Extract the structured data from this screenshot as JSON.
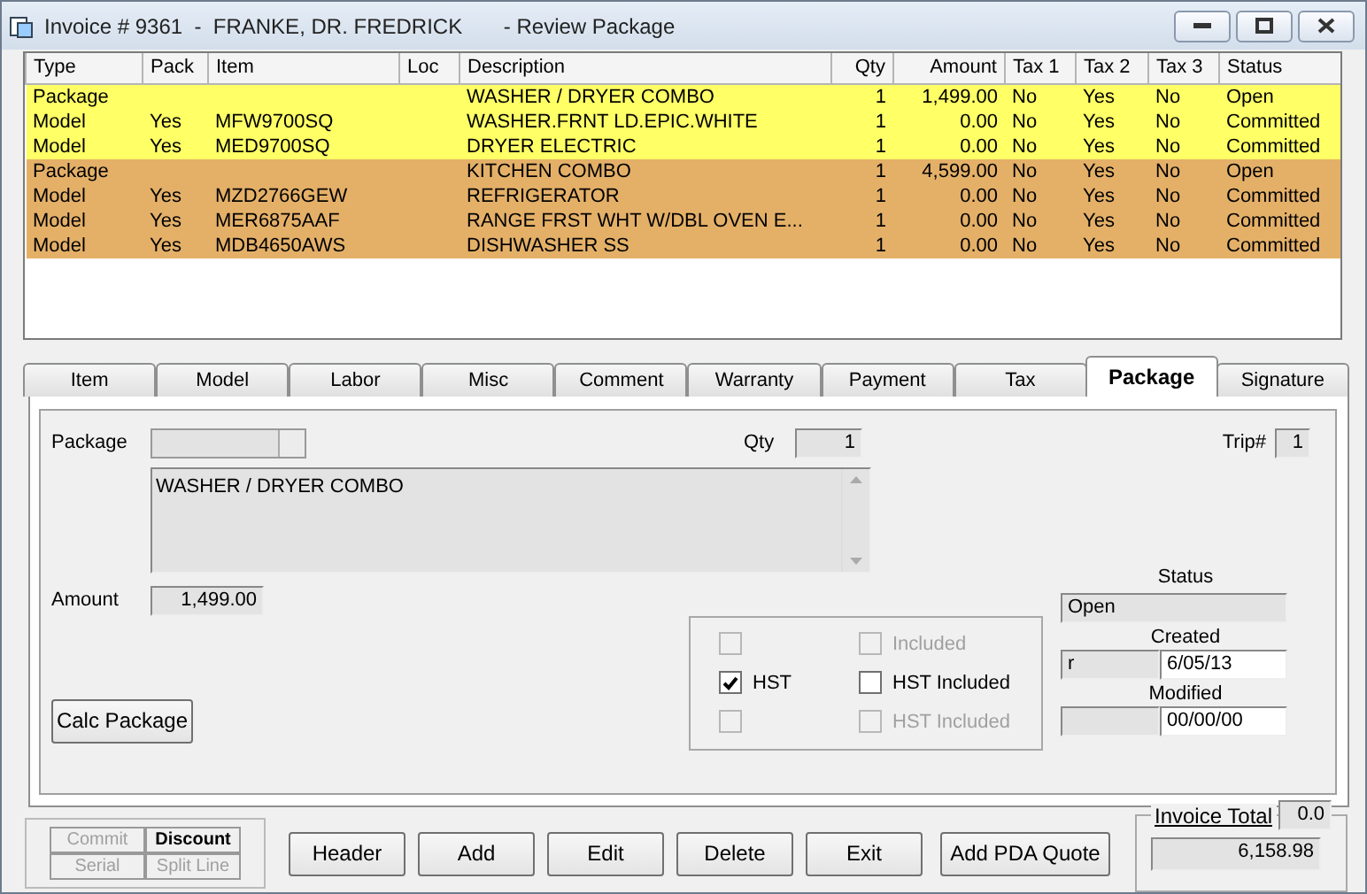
{
  "window": {
    "title": "Invoice # 9361  -  FRANKE, DR. FREDRICK       - Review Package"
  },
  "table": {
    "columns": [
      "Type",
      "Pack",
      "Item",
      "Loc",
      "Description",
      "Qty",
      "Amount",
      "Tax 1",
      "Tax 2",
      "Tax 3",
      "Status"
    ],
    "rows": [
      {
        "color": "#ffff66",
        "cells": [
          "Package",
          "",
          "",
          "",
          "WASHER / DRYER COMBO",
          "1",
          "1,499.00",
          "No",
          "Yes",
          "No",
          "Open"
        ]
      },
      {
        "color": "#ffff66",
        "cells": [
          "Model",
          "Yes",
          "MFW9700SQ",
          "",
          "WASHER.FRNT LD.EPIC.WHITE",
          "1",
          "0.00",
          "No",
          "Yes",
          "No",
          "Committed"
        ]
      },
      {
        "color": "#ffff66",
        "cells": [
          "Model",
          "Yes",
          "MED9700SQ",
          "",
          "DRYER ELECTRIC",
          "1",
          "0.00",
          "No",
          "Yes",
          "No",
          "Committed"
        ]
      },
      {
        "color": "#e4b068",
        "cells": [
          "Package",
          "",
          "",
          "",
          "KITCHEN COMBO",
          "1",
          "4,599.00",
          "No",
          "Yes",
          "No",
          "Open"
        ]
      },
      {
        "color": "#e4b068",
        "cells": [
          "Model",
          "Yes",
          "MZD2766GEW",
          "",
          "REFRIGERATOR",
          "1",
          "0.00",
          "No",
          "Yes",
          "No",
          "Committed"
        ]
      },
      {
        "color": "#e4b068",
        "cells": [
          "Model",
          "Yes",
          "MER6875AAF",
          "",
          "RANGE FRST WHT W/DBL OVEN E...",
          "1",
          "0.00",
          "No",
          "Yes",
          "No",
          "Committed"
        ]
      },
      {
        "color": "#e4b068",
        "cells": [
          "Model",
          "Yes",
          "MDB4650AWS",
          "",
          "DISHWASHER SS",
          "1",
          "0.00",
          "No",
          "Yes",
          "No",
          "Committed"
        ]
      }
    ]
  },
  "tabs": [
    {
      "label": "Item",
      "selected": false
    },
    {
      "label": "Model",
      "selected": false
    },
    {
      "label": "Labor",
      "selected": false
    },
    {
      "label": "Misc",
      "selected": false
    },
    {
      "label": "Comment",
      "selected": false
    },
    {
      "label": "Warranty",
      "selected": false
    },
    {
      "label": "Payment",
      "selected": false
    },
    {
      "label": "Tax",
      "selected": false
    },
    {
      "label": "Package",
      "selected": true
    },
    {
      "label": "Signature",
      "selected": false
    }
  ],
  "package_form": {
    "package_label": "Package",
    "qty_label": "Qty",
    "qty": "1",
    "trip_label": "Trip#",
    "trip": "1",
    "description": "WASHER / DRYER COMBO",
    "amount_label": "Amount",
    "amount": "1,499.00",
    "calc_button": "Calc Package",
    "tax_options": [
      {
        "checked": false,
        "disabled": true,
        "included_label": "Included",
        "included_checked": false,
        "included_disabled": true
      },
      {
        "label": "HST",
        "checked": true,
        "disabled": false,
        "included_label": "HST Included",
        "included_checked": false,
        "included_disabled": false
      },
      {
        "checked": false,
        "disabled": true,
        "included_label": "HST Included",
        "included_checked": false,
        "included_disabled": true
      }
    ],
    "status_label": "Status",
    "status": "Open",
    "created_label": "Created",
    "created_by": "r",
    "created": "6/05/13",
    "modified_label": "Modified",
    "modified": "00/00/00"
  },
  "bottom_bar": {
    "small_buttons": [
      {
        "label": "Commit",
        "disabled": true
      },
      {
        "label": "Discount",
        "disabled": false
      },
      {
        "label": "Serial",
        "disabled": true
      },
      {
        "label": "Split Line",
        "disabled": true
      }
    ],
    "buttons": [
      "Header",
      "Add",
      "Edit",
      "Delete",
      "Exit",
      "Add PDA Quote"
    ],
    "invoice_total": {
      "label": "Invoice Total",
      "small_value": "0.0",
      "total": "6,158.98"
    }
  }
}
